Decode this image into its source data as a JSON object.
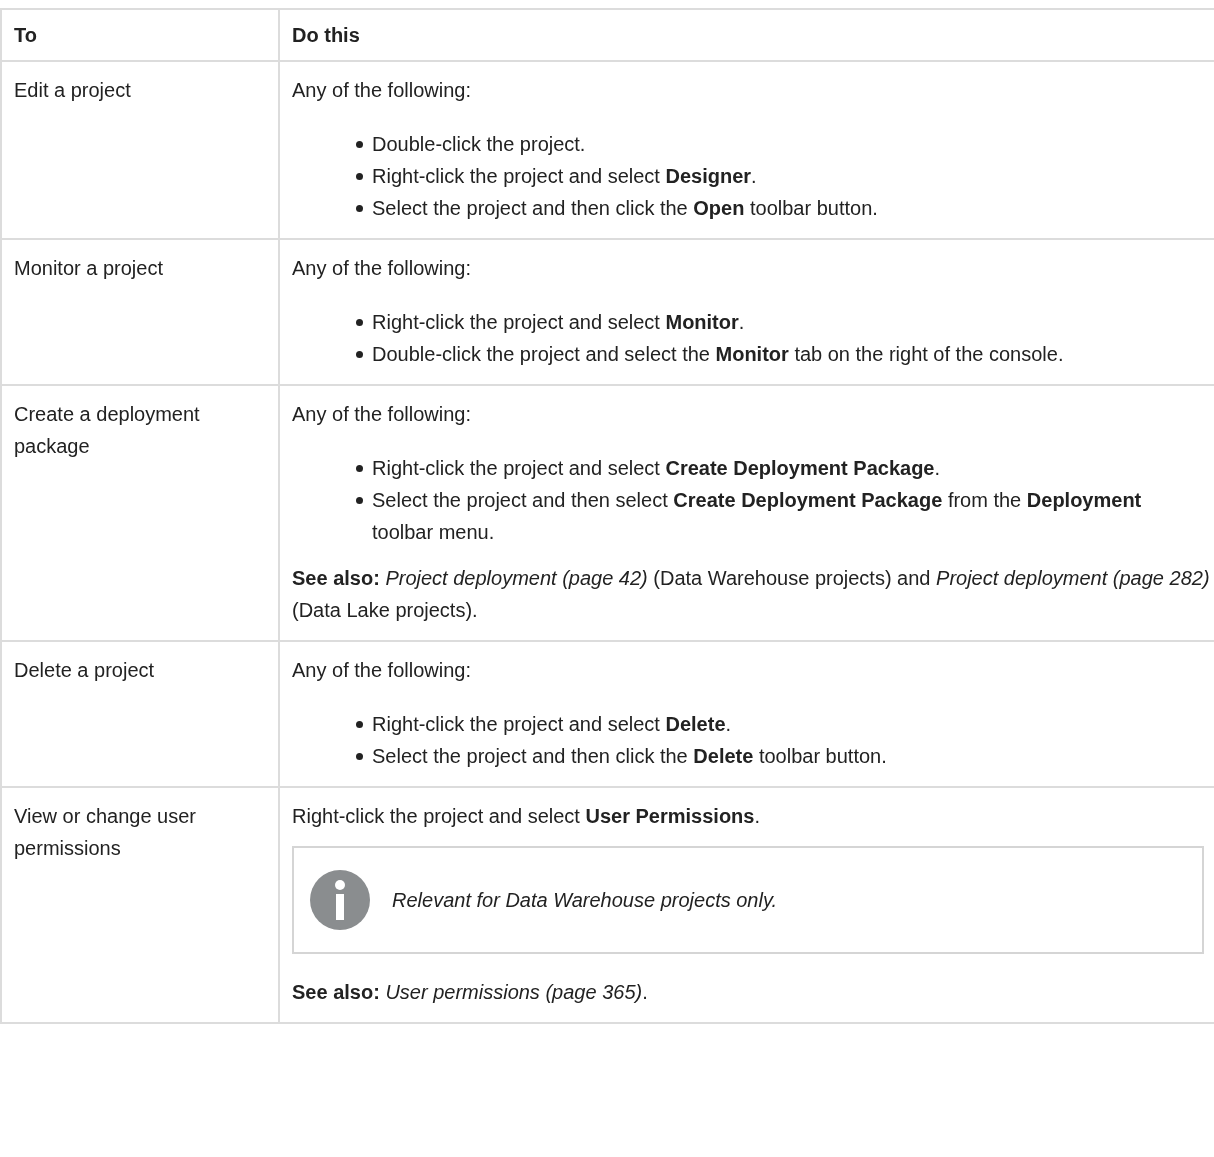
{
  "table": {
    "columns": [
      "To",
      "Do this"
    ],
    "rows": [
      {
        "to": "Edit a project",
        "blocks": [
          {
            "kind": "para",
            "text": "Any of the following:"
          },
          {
            "kind": "bullets",
            "items": [
              "Double-click the project.",
              "Right-click the project and select **Designer**.",
              "Select the project and then click the **Open** toolbar button."
            ]
          }
        ]
      },
      {
        "to": "Monitor a project",
        "blocks": [
          {
            "kind": "para",
            "text": "Any of the following:"
          },
          {
            "kind": "bullets",
            "items": [
              "Right-click the project and select **Monitor**.",
              "Double-click the project and select the **Monitor** tab on the right of the console."
            ]
          }
        ]
      },
      {
        "to": "Create a deployment package",
        "blocks": [
          {
            "kind": "para",
            "text": "Any of the following:"
          },
          {
            "kind": "bullets",
            "items": [
              "Right-click the project and select **Create Deployment Package**.",
              "Select the project and then select **Create Deployment Package** from the **Deployment** toolbar menu."
            ]
          },
          {
            "kind": "para",
            "text": "**See also:** *Project deployment (page 42)* (Data Warehouse projects) and *Project deployment (page 282)* (Data Lake projects)."
          }
        ]
      },
      {
        "to": "Delete a project",
        "blocks": [
          {
            "kind": "para",
            "text": "Any of the following:"
          },
          {
            "kind": "bullets",
            "items": [
              "Right-click the project and select **Delete**.",
              "Select the project and then click the **Delete** toolbar button."
            ]
          }
        ]
      },
      {
        "to": "View or change user permissions",
        "blocks": [
          {
            "kind": "para",
            "text": "Right-click the project and select **User Permissions**."
          },
          {
            "kind": "note",
            "text": "Relevant for Data Warehouse projects only."
          },
          {
            "kind": "para",
            "text": "**See also:** *User permissions (page 365)*."
          }
        ]
      }
    ]
  }
}
